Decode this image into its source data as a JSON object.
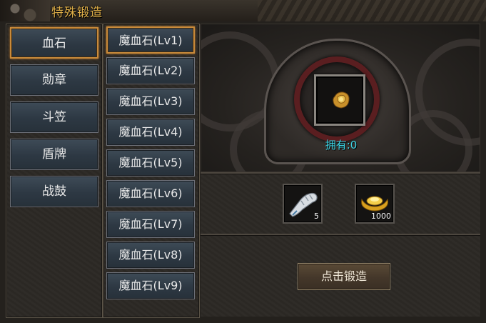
{
  "window": {
    "title": "特殊锻造"
  },
  "categories": [
    {
      "label": "血石",
      "selected": true
    },
    {
      "label": "勋章",
      "selected": false
    },
    {
      "label": "斗笠",
      "selected": false
    },
    {
      "label": "盾牌",
      "selected": false
    },
    {
      "label": "战鼓",
      "selected": false
    }
  ],
  "items": [
    {
      "label": "魔血石(Lv1)",
      "selected": true
    },
    {
      "label": "魔血石(Lv2)",
      "selected": false
    },
    {
      "label": "魔血石(Lv3)",
      "selected": false
    },
    {
      "label": "魔血石(Lv4)",
      "selected": false
    },
    {
      "label": "魔血石(Lv5)",
      "selected": false
    },
    {
      "label": "魔血石(Lv6)",
      "selected": false
    },
    {
      "label": "魔血石(Lv7)",
      "selected": false
    },
    {
      "label": "魔血石(Lv8)",
      "selected": false
    },
    {
      "label": "魔血石(Lv9)",
      "selected": false
    }
  ],
  "preview": {
    "item_icon": "blood-stone-icon",
    "owned_text": "拥有:0"
  },
  "materials": [
    {
      "icon": "bone-fragment-icon",
      "count": "5"
    },
    {
      "icon": "gold-ingot-icon",
      "count": "1000"
    }
  ],
  "forge_button": {
    "label": "点击锻造"
  },
  "colors": {
    "title": "#e0b04a",
    "owned_text": "#3fd7e8",
    "selected_border": "#c98a3a",
    "button_bg": "#2d3843"
  }
}
